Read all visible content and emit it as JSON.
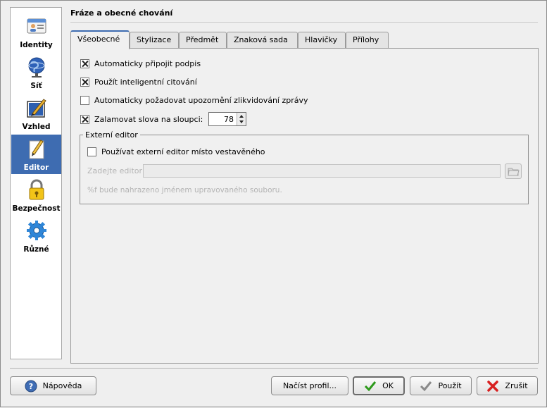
{
  "sidebar": {
    "items": [
      {
        "label": "Identity",
        "icon": "identity-card-icon"
      },
      {
        "label": "Síť",
        "icon": "network-globe-icon"
      },
      {
        "label": "Vzhled",
        "icon": "appearance-paint-icon"
      },
      {
        "label": "Editor",
        "icon": "editor-pencil-icon"
      },
      {
        "label": "Bezpečnost",
        "icon": "security-lock-icon"
      },
      {
        "label": "Různé",
        "icon": "misc-gear-icon"
      }
    ],
    "selected": "Editor"
  },
  "page": {
    "title": "Fráze a obecné chování"
  },
  "tabs": [
    {
      "label": "Všeobecné",
      "active": true
    },
    {
      "label": "Stylizace"
    },
    {
      "label": "Předmět"
    },
    {
      "label": "Znaková sada"
    },
    {
      "label": "Hlavičky"
    },
    {
      "label": "Přílohy"
    }
  ],
  "general": {
    "auto_signature": {
      "label": "Automaticky připojit podpis",
      "checked": true
    },
    "smart_quoting": {
      "label": "Použít inteligentní citování",
      "checked": true
    },
    "request_mdn": {
      "label": "Automaticky požadovat upozornění zlikvidování zprávy",
      "checked": false
    },
    "word_wrap": {
      "label": "Zalamovat slova na sloupci:",
      "checked": true,
      "column": "78"
    }
  },
  "external_editor": {
    "group_title": "Externí editor",
    "use_external": {
      "label": "Používat externí editor místo vestavěného",
      "checked": false
    },
    "editor_label": "Zadejte editor:",
    "editor_value": "",
    "hint": "%f bude nahrazeno jménem upravovaného souboru."
  },
  "buttons": {
    "help": "Nápověda",
    "load_profile": "Načíst profil...",
    "ok": "OK",
    "apply": "Použít",
    "cancel": "Zrušit"
  },
  "colors": {
    "selection": "#3e6cb1",
    "ok_check": "#2e9a1c",
    "cancel_x": "#d82020",
    "help_icon": "#3f6db5"
  }
}
